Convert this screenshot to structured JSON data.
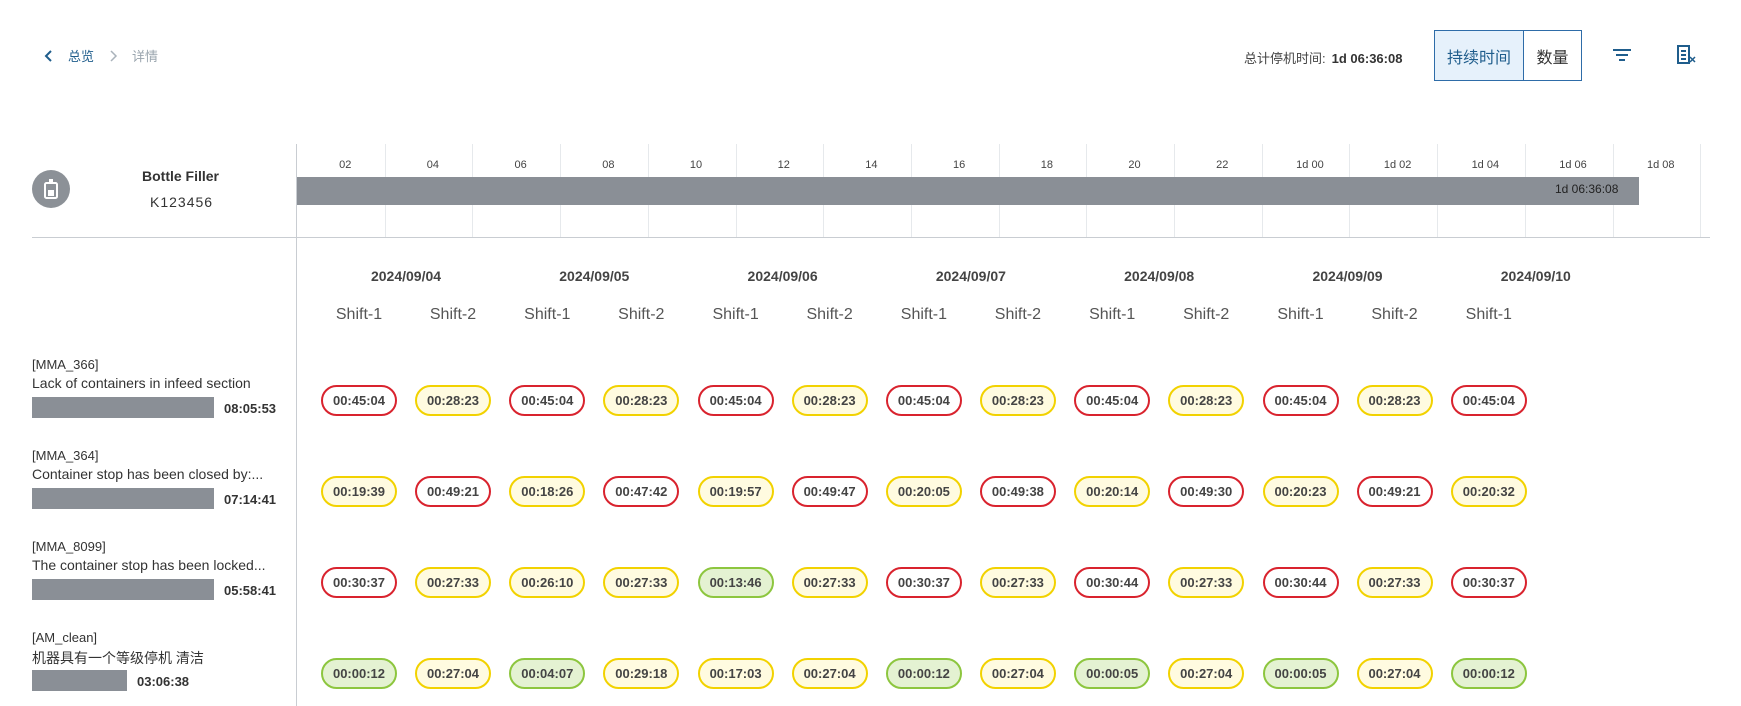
{
  "breadcrumb": {
    "home": "总览",
    "current": "详情"
  },
  "summary": {
    "label": "总计停机时间:",
    "value": "1d 06:36:08"
  },
  "view_toggle": {
    "duration": "持续时间",
    "count": "数量"
  },
  "icons": {
    "back": "chevron-left-icon",
    "separator": "chevron-right-icon",
    "filter": "filter-icon",
    "export": "export-xls-icon",
    "machine": "bottle-filler-icon"
  },
  "colors": {
    "accent": "#1f5d8c",
    "red": "#d9232e",
    "yellow": "#f2d200",
    "green": "#8dc63f",
    "bar": "#8a8f96"
  },
  "machine": {
    "name": "Bottle Filler",
    "id": "K123456"
  },
  "timeline": {
    "ticks": [
      "02",
      "04",
      "06",
      "08",
      "10",
      "12",
      "14",
      "16",
      "18",
      "20",
      "22",
      "1d 00",
      "1d 02",
      "1d 04",
      "1d 06",
      "1d 08"
    ],
    "bar_label": "1d 06:36:08",
    "bar_hours": 30.6
  },
  "dates": [
    "2024/09/04",
    "2024/09/05",
    "2024/09/06",
    "2024/09/07",
    "2024/09/08",
    "2024/09/09",
    "2024/09/10"
  ],
  "shifts": [
    "Shift-1",
    "Shift-2",
    "Shift-1",
    "Shift-2",
    "Shift-1",
    "Shift-2",
    "Shift-1",
    "Shift-2",
    "Shift-1",
    "Shift-2",
    "Shift-1",
    "Shift-2",
    "Shift-1"
  ],
  "rows": [
    {
      "code": "[MMA_366]",
      "description": "Lack of containers in infeed section",
      "total": "08:05:53",
      "bar_fraction": 1.0,
      "cells": [
        {
          "v": "00:45:04",
          "c": "red"
        },
        {
          "v": "00:28:23",
          "c": "yellow"
        },
        {
          "v": "00:45:04",
          "c": "red"
        },
        {
          "v": "00:28:23",
          "c": "yellow"
        },
        {
          "v": "00:45:04",
          "c": "red"
        },
        {
          "v": "00:28:23",
          "c": "yellow"
        },
        {
          "v": "00:45:04",
          "c": "red"
        },
        {
          "v": "00:28:23",
          "c": "yellow"
        },
        {
          "v": "00:45:04",
          "c": "red"
        },
        {
          "v": "00:28:23",
          "c": "yellow"
        },
        {
          "v": "00:45:04",
          "c": "red"
        },
        {
          "v": "00:28:23",
          "c": "yellow"
        },
        {
          "v": "00:45:04",
          "c": "red"
        }
      ]
    },
    {
      "code": "[MMA_364]",
      "description": "Container stop has been closed by:...",
      "total": "07:14:41",
      "bar_fraction": 1.0,
      "cells": [
        {
          "v": "00:19:39",
          "c": "yellow"
        },
        {
          "v": "00:49:21",
          "c": "red"
        },
        {
          "v": "00:18:26",
          "c": "yellow"
        },
        {
          "v": "00:47:42",
          "c": "red"
        },
        {
          "v": "00:19:57",
          "c": "yellow"
        },
        {
          "v": "00:49:47",
          "c": "red"
        },
        {
          "v": "00:20:05",
          "c": "yellow"
        },
        {
          "v": "00:49:38",
          "c": "red"
        },
        {
          "v": "00:20:14",
          "c": "yellow"
        },
        {
          "v": "00:49:30",
          "c": "red"
        },
        {
          "v": "00:20:23",
          "c": "yellow"
        },
        {
          "v": "00:49:21",
          "c": "red"
        },
        {
          "v": "00:20:32",
          "c": "yellow"
        }
      ]
    },
    {
      "code": "[MMA_8099]",
      "description": "The container stop has been locked...",
      "total": "05:58:41",
      "bar_fraction": 1.0,
      "cells": [
        {
          "v": "00:30:37",
          "c": "red"
        },
        {
          "v": "00:27:33",
          "c": "yellow"
        },
        {
          "v": "00:26:10",
          "c": "yellow"
        },
        {
          "v": "00:27:33",
          "c": "yellow"
        },
        {
          "v": "00:13:46",
          "c": "green"
        },
        {
          "v": "00:27:33",
          "c": "yellow"
        },
        {
          "v": "00:30:37",
          "c": "red"
        },
        {
          "v": "00:27:33",
          "c": "yellow"
        },
        {
          "v": "00:30:44",
          "c": "red"
        },
        {
          "v": "00:27:33",
          "c": "yellow"
        },
        {
          "v": "00:30:44",
          "c": "red"
        },
        {
          "v": "00:27:33",
          "c": "yellow"
        },
        {
          "v": "00:30:37",
          "c": "red"
        }
      ]
    },
    {
      "code": "[AM_clean]",
      "description": "机器具有一个等级停机 清洁",
      "total": "03:06:38",
      "bar_fraction": 0.52,
      "cells": [
        {
          "v": "00:00:12",
          "c": "green"
        },
        {
          "v": "00:27:04",
          "c": "yellow"
        },
        {
          "v": "00:04:07",
          "c": "green"
        },
        {
          "v": "00:29:18",
          "c": "yellow"
        },
        {
          "v": "00:17:03",
          "c": "yellow"
        },
        {
          "v": "00:27:04",
          "c": "yellow"
        },
        {
          "v": "00:00:12",
          "c": "green"
        },
        {
          "v": "00:27:04",
          "c": "yellow"
        },
        {
          "v": "00:00:05",
          "c": "green"
        },
        {
          "v": "00:27:04",
          "c": "yellow"
        },
        {
          "v": "00:00:05",
          "c": "green"
        },
        {
          "v": "00:27:04",
          "c": "yellow"
        },
        {
          "v": "00:00:12",
          "c": "green"
        }
      ]
    }
  ]
}
